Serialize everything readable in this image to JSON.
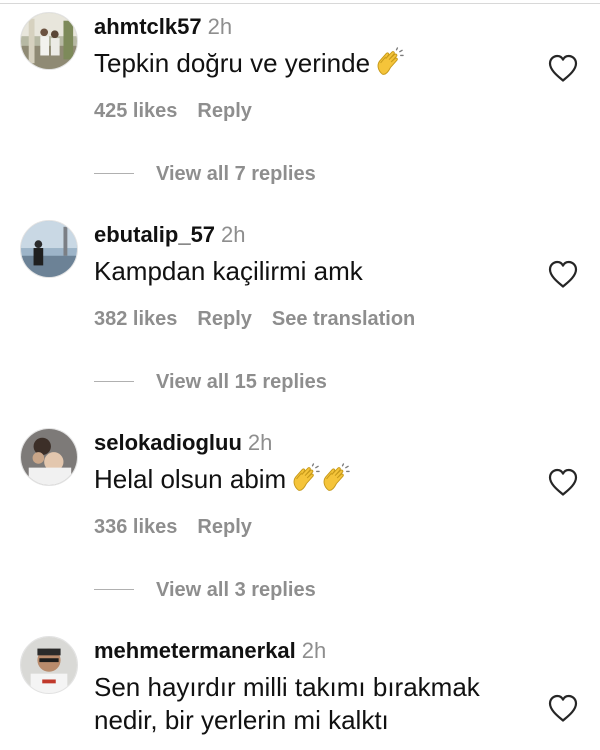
{
  "comments": [
    {
      "username": "ahmtclk57",
      "time": "2h",
      "text": "Tepkin doğru ve yerinde",
      "clap_count": 1,
      "likes": "425 likes",
      "reply": "Reply",
      "view_replies": "View all 7 replies"
    },
    {
      "username": "ebutalip_57",
      "time": "2h",
      "text": "Kampdan kaçilirmi amk",
      "clap_count": 0,
      "likes": "382 likes",
      "reply": "Reply",
      "see_translation": "See translation",
      "view_replies": "View all 15 replies"
    },
    {
      "username": "selokadiogluu",
      "time": "2h",
      "text": "Helal olsun abim",
      "clap_count": 2,
      "likes": "336 likes",
      "reply": "Reply",
      "view_replies": "View all 3 replies"
    },
    {
      "username": "mehmetermanerkal",
      "time": "2h",
      "text": "Sen hayırdır milli takımı bırakmak nedir, bir yerlerin mi kalktı",
      "clap_count": 0
    }
  ],
  "icons": {
    "heart": "heart-outline-icon",
    "clap": "clapping-hands-emoji"
  },
  "colors": {
    "text": "#111111",
    "muted": "#8e8e8e",
    "clap": "#f5c43a"
  }
}
